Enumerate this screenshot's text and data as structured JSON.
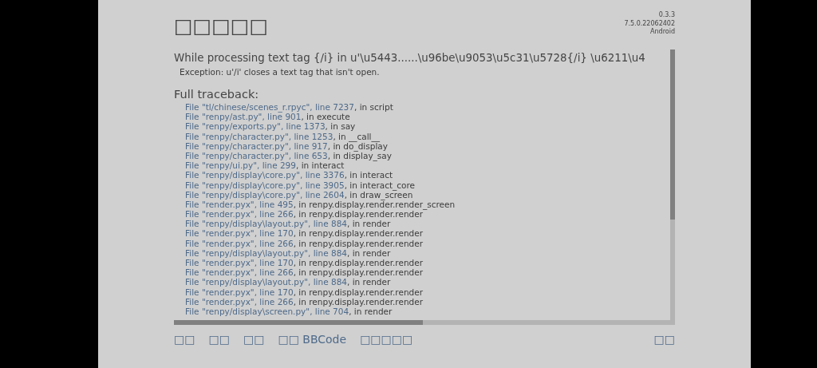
{
  "title": "□□□□□",
  "version": [
    "0.3.3",
    "7.5.0.22062402",
    "Android"
  ],
  "error_heading": "While processing text tag {/i} in u'\\u5443......\\u96be\\u9053\\u5c31\\u5728{/i} \\u6211\\u4",
  "exception": "Exception: u'/i' closes a text tag that isn't open.",
  "traceback_heading": "Full traceback:",
  "traceback": [
    {
      "link": "File \"tl/chinese/scenes_r.rpyc\", line 7237",
      "rest": ", in script"
    },
    {
      "link": "File \"renpy/ast.py\", line 901",
      "rest": ", in execute"
    },
    {
      "link": "File \"renpy/exports.py\", line 1373",
      "rest": ", in say"
    },
    {
      "link": "File \"renpy/character.py\", line 1253",
      "rest": ", in __call__"
    },
    {
      "link": "File \"renpy/character.py\", line 917",
      "rest": ", in do_display"
    },
    {
      "link": "File \"renpy/character.py\", line 653",
      "rest": ", in display_say"
    },
    {
      "link": "File \"renpy/ui.py\", line 299",
      "rest": ", in interact"
    },
    {
      "link": "File \"renpy/display\\core.py\", line 3376",
      "rest": ", in interact"
    },
    {
      "link": "File \"renpy/display\\core.py\", line 3905",
      "rest": ", in interact_core"
    },
    {
      "link": "File \"renpy/display\\core.py\", line 2604",
      "rest": ", in draw_screen"
    },
    {
      "link": "File \"render.pyx\", line 495",
      "rest": ", in renpy.display.render.render_screen"
    },
    {
      "link": "File \"render.pyx\", line 266",
      "rest": ", in renpy.display.render.render"
    },
    {
      "link": "File \"renpy/display\\layout.py\", line 884",
      "rest": ", in render"
    },
    {
      "link": "File \"render.pyx\", line 170",
      "rest": ", in renpy.display.render.render"
    },
    {
      "link": "File \"render.pyx\", line 266",
      "rest": ", in renpy.display.render.render"
    },
    {
      "link": "File \"renpy/display\\layout.py\", line 884",
      "rest": ", in render"
    },
    {
      "link": "File \"render.pyx\", line 170",
      "rest": ", in renpy.display.render.render"
    },
    {
      "link": "File \"render.pyx\", line 266",
      "rest": ", in renpy.display.render.render"
    },
    {
      "link": "File \"renpy/display\\layout.py\", line 884",
      "rest": ", in render"
    },
    {
      "link": "File \"render.pyx\", line 170",
      "rest": ", in renpy.display.render.render"
    },
    {
      "link": "File \"render.pyx\", line 266",
      "rest": ", in renpy.display.render.render"
    },
    {
      "link": "File \"renpy/display\\screen.py\", line 704",
      "rest": ", in render"
    }
  ],
  "actions": [
    "□□",
    "□□",
    "□□",
    "□□ BBCode",
    "□□□□□"
  ],
  "quit": "□□"
}
